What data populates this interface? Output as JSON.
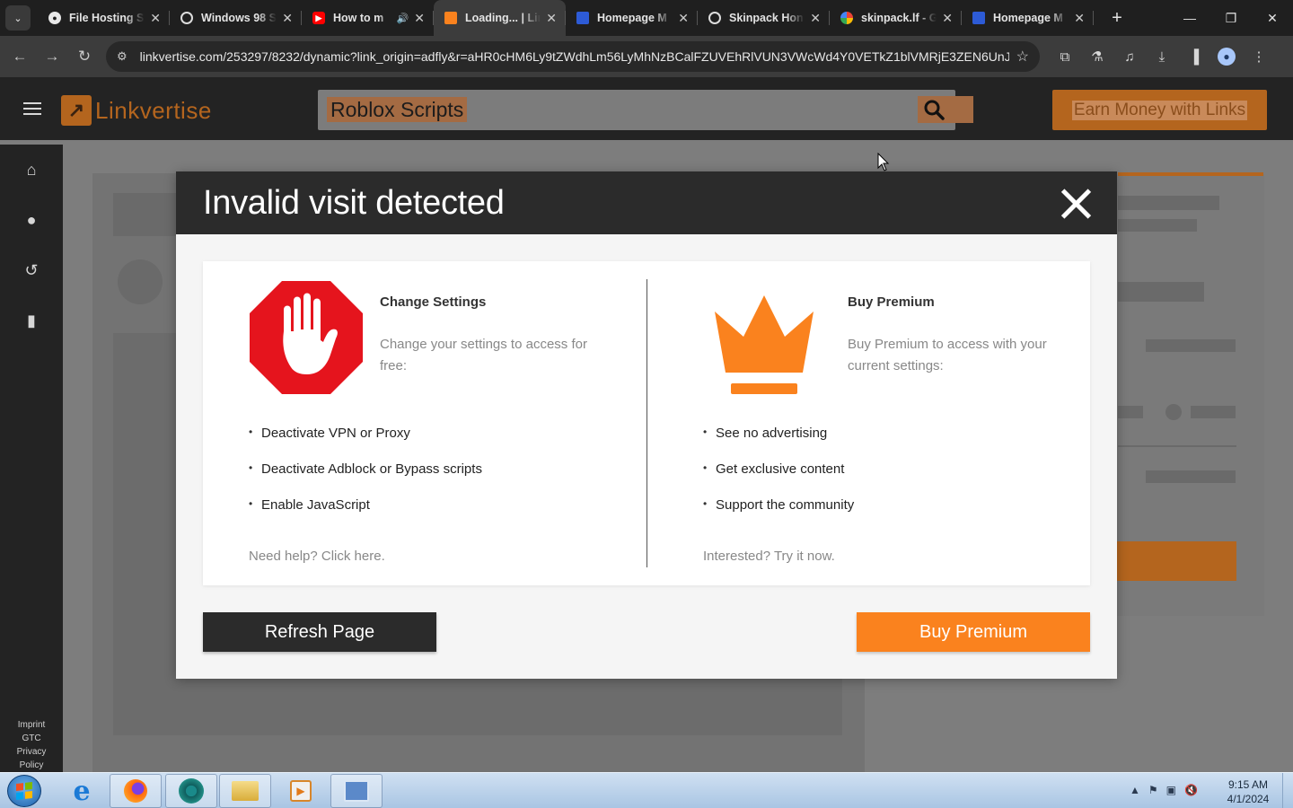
{
  "browser": {
    "tabs": [
      {
        "title": "File Hosting S",
        "icon": "person-icon",
        "active": false,
        "audio": false
      },
      {
        "title": "Windows 98 S",
        "icon": "swirl-icon",
        "active": false,
        "audio": false
      },
      {
        "title": "How to m",
        "icon": "youtube-icon",
        "active": false,
        "audio": true
      },
      {
        "title": "Loading... | Lin",
        "icon": "linkvertise-icon",
        "active": true,
        "audio": false
      },
      {
        "title": "Homepage M",
        "icon": "windows-icon",
        "active": false,
        "audio": false
      },
      {
        "title": "Skinpack Hon",
        "icon": "swirl-icon",
        "active": false,
        "audio": false
      },
      {
        "title": "skinpack.lf - G",
        "icon": "google-icon",
        "active": false,
        "audio": false
      },
      {
        "title": "Homepage M",
        "icon": "windows-icon",
        "active": false,
        "audio": false
      }
    ],
    "url": "linkvertise.com/253297/8232/dynamic?link_origin=adfly&r=aHR0cHM6Ly9tZWdhLm56LyMhNzBCalFZUVEhRlVUN3VWcWd4Y0VETkZ1blVMRjE3ZEN6UnJk..."
  },
  "site": {
    "logo_text": "Linkvertise",
    "search_term": "Roblox Scripts",
    "earn_button": "Earn Money with Links",
    "footer_links": [
      "Imprint",
      "GTC",
      "Privacy",
      "Policy"
    ],
    "accent_color": "#fa821e"
  },
  "modal": {
    "title": "Invalid visit detected",
    "left": {
      "heading": "Change Settings",
      "description": "Change your settings to access for free:",
      "bullets": [
        "Deactivate VPN or Proxy",
        "Deactivate Adblock or Bypass scripts",
        "Enable JavaScript"
      ],
      "footer": "Need help? Click here.",
      "icon": "stop-hand-icon"
    },
    "right": {
      "heading": "Buy Premium",
      "description": "Buy Premium to access with your current settings:",
      "bullets": [
        "See no advertising",
        "Get exclusive content",
        "Support the community"
      ],
      "footer": "Interested? Try it now.",
      "icon": "crown-icon"
    },
    "refresh_button": "Refresh Page",
    "premium_button": "Buy Premium"
  },
  "taskbar": {
    "time": "9:15 AM",
    "date": "4/1/2024"
  }
}
